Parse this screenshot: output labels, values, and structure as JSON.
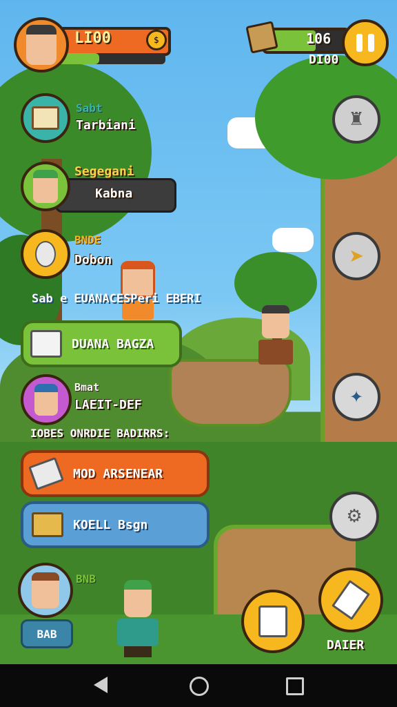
{
  "hud": {
    "player_gold": "LI00",
    "gem_count": "106",
    "sub_count": "DI00",
    "coin_icon": "coin-icon",
    "pause_icon": "pause-icon"
  },
  "menu": [
    {
      "title": "Sabt",
      "subtitle": "Tarbiani",
      "icon": "scroll-icon"
    },
    {
      "title": "Segegani",
      "subtitle": "Kabna",
      "icon": "avatar-icon"
    },
    {
      "title": "BNDE",
      "subtitle": "Dobon",
      "icon": "egg-icon"
    }
  ],
  "banner_text": "Sab e EUANACESPeri EBERI",
  "buttons": {
    "green": "DUANA BAGZA",
    "orange": "MOD ARSENEAR",
    "blue": "KOELL Bsgn"
  },
  "character_card": {
    "title": "Bmat",
    "subtitle": "LAEIT-DEF"
  },
  "caption_text": "IOBES ONRDIE BADIRRS:",
  "bottom_left": {
    "title": "BNB",
    "badge": "BAB"
  },
  "bottom_right_label": "DAIER",
  "right_tools": [
    "castle-icon",
    "arrow-icon",
    "compass-icon",
    "gear-icon"
  ],
  "colors": {
    "green_btn": "#7bc23b",
    "orange_btn": "#ee6a22",
    "blue_btn": "#5aa0d6",
    "gold": "#f7b71f"
  }
}
